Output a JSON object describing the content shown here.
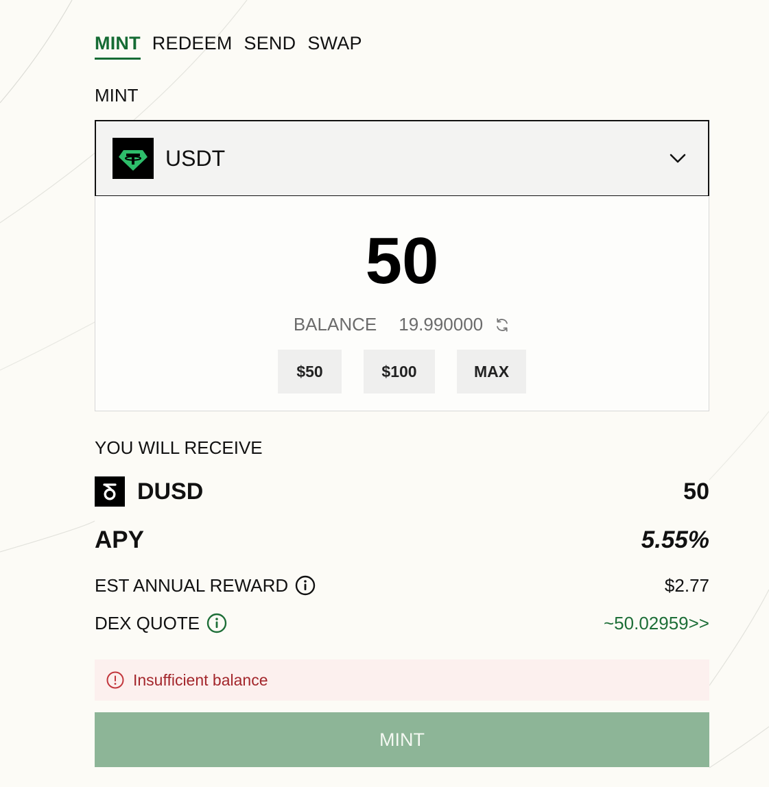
{
  "tabs": [
    {
      "label": "MINT",
      "active": true
    },
    {
      "label": "REDEEM",
      "active": false
    },
    {
      "label": "SEND",
      "active": false
    },
    {
      "label": "SWAP",
      "active": false
    }
  ],
  "mint_section": {
    "label": "MINT",
    "token": {
      "symbol": "USDT",
      "icon": "tether-logo-icon",
      "icon_color": "#2ebd6b"
    },
    "amount": "50",
    "balance_label": "BALANCE",
    "balance_value": "19.990000",
    "quick_amounts": [
      "$50",
      "$100",
      "MAX"
    ]
  },
  "receive_section": {
    "label": "YOU WILL RECEIVE",
    "token": "DUSD",
    "icon": "dusd-logo-icon",
    "amount": "50",
    "apy_label": "APY",
    "apy_value": "5.55%",
    "est_reward_label": "EST ANNUAL REWARD",
    "est_reward_value": "$2.77",
    "dex_quote_label": "DEX QUOTE",
    "dex_quote_value": "~50.02959>>"
  },
  "error": {
    "message": "Insufficient balance",
    "color": "#a3262b"
  },
  "mint_button": {
    "label": "MINT",
    "color": "#8db597"
  },
  "colors": {
    "accent": "#156b34",
    "background": "#fcfbf6"
  }
}
